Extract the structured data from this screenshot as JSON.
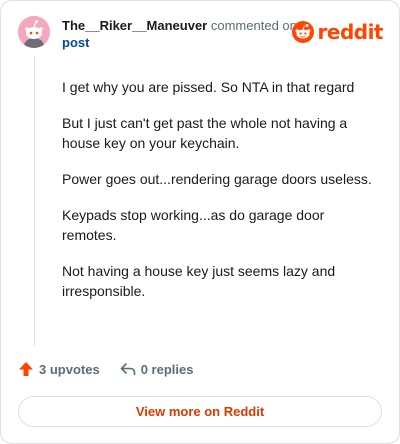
{
  "header": {
    "username": "The__Riker__Maneuver",
    "action_text": "commented on",
    "post_link": "post",
    "avatar_icon": "snoo-avatar-icon"
  },
  "brand": {
    "name": "reddit",
    "logo_icon": "reddit-logo-icon",
    "accent_color": "#ff4500"
  },
  "comment": {
    "paragraphs": [
      "I get why you are pissed. So NTA in that regard",
      "But I just can't get past the whole not having a house key on your keychain.",
      "Power goes out...rendering garage doors useless.",
      "Keypads stop working...as do garage door remotes.",
      "Not having a house key just seems lazy and irresponsible."
    ]
  },
  "actions": {
    "upvotes": "3 upvotes",
    "replies": "0 replies",
    "upvote_icon": "upvote-arrow-icon",
    "reply_icon": "reply-arrow-icon"
  },
  "footer": {
    "view_more": "View more on Reddit"
  }
}
